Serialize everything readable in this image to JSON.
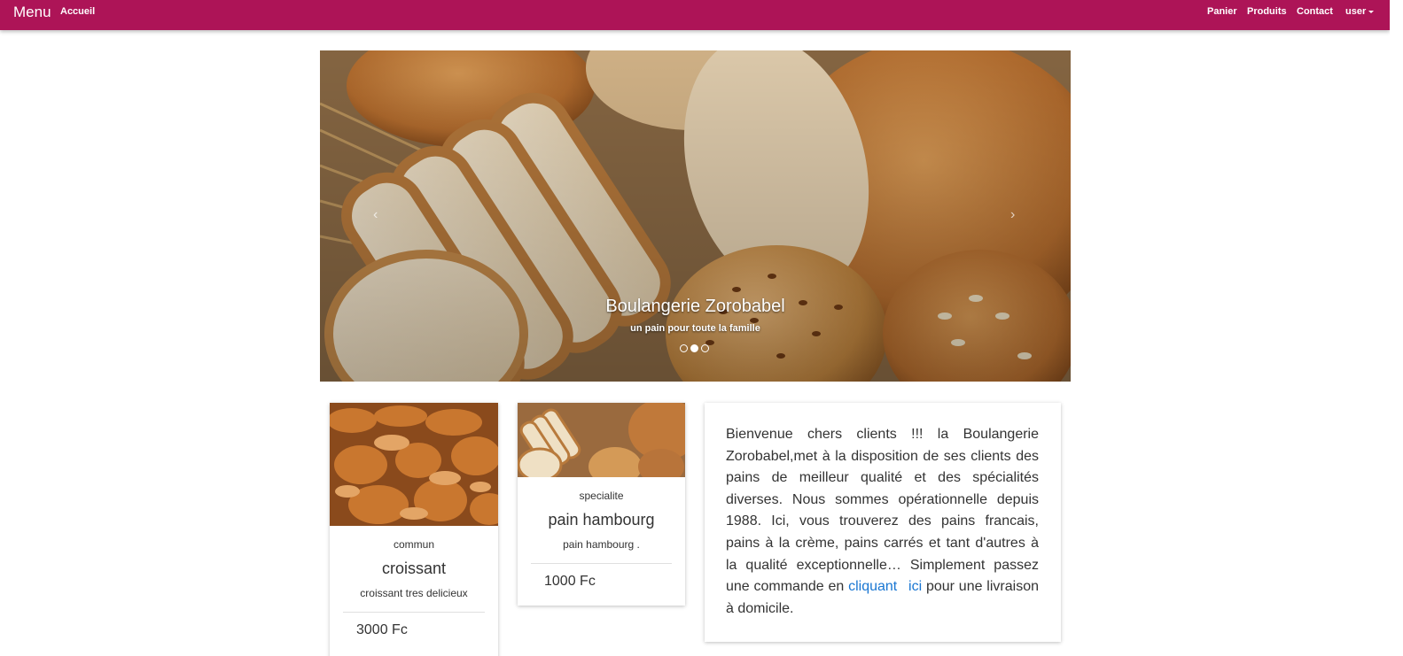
{
  "nav": {
    "brand": "Menu",
    "home": "Accueil",
    "cart": "Panier",
    "products": "Produits",
    "contact": "Contact",
    "user": "user"
  },
  "carousel": {
    "title": "Boulangerie Zorobabel",
    "subtitle": "un pain pour toute la famille",
    "prev": "‹",
    "next": "›",
    "slides": 3,
    "active_slide": 2
  },
  "products": [
    {
      "category": "commun",
      "name": "croissant",
      "description": "croissant tres delicieux",
      "price": "3000 Fc"
    },
    {
      "category": "specialite",
      "name": "pain hambourg",
      "description": "pain hambourg .",
      "price": "1000 Fc"
    }
  ],
  "welcome": {
    "text_before": "Bienvenue chers clients !!! la Boulangerie Zorobabel,met à la disposition de ses clients des pains de meilleur qualité et des spécialités diverses. Nous sommes opérationnelle depuis 1988. Ici, vous trouverez des pains francais, pains à la crème, pains carrés et tant d'autres à la qualité exceptionnelle… Simplement passez une commande en ",
    "link": "cliquant ici",
    "text_after": " pour une livraison à domicile."
  },
  "colors": {
    "navbar": "#ad1457",
    "link": "#1976d2"
  }
}
